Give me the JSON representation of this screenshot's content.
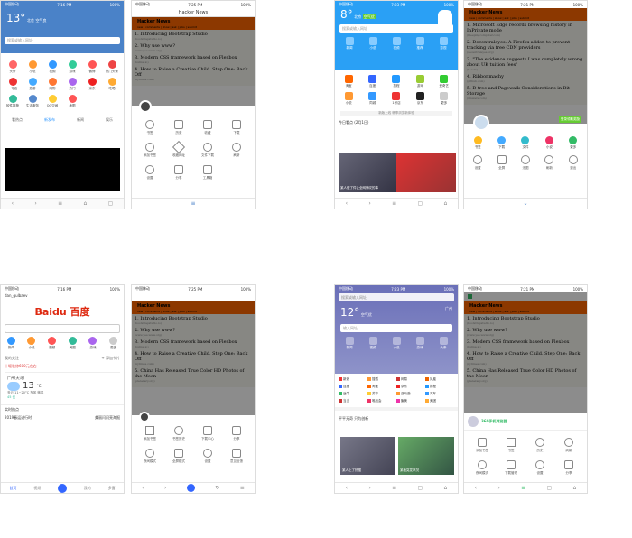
{
  "status": {
    "carrier": "中国移动",
    "time_a": "7:16 PM",
    "time_b": "7:25 PM",
    "time_c": "7:23 PM",
    "time_d": "7:21 PM",
    "battery": "100%"
  },
  "s1": {
    "temp": "13°",
    "city": "北京",
    "sub": "空气良",
    "search_placeholder": "搜索或输入网址",
    "icons_row1": [
      "头条",
      "小说",
      "视频",
      "游戏",
      "微博",
      "热门头条"
    ],
    "icons_row2": [
      "一号店",
      "旅游",
      "网购",
      "热门",
      "京东",
      "吃喝"
    ],
    "icons_row3": [
      "软件推荐",
      "生活服务",
      "QQ空间",
      "地图"
    ],
    "tabs": [
      "看热点",
      "新发布",
      "新闻",
      "娱乐"
    ]
  },
  "hn": {
    "title": "Hacker News",
    "subtitle": "new | comments | show | ask | jobs | submit",
    "login": "login",
    "items": [
      {
        "n": "1.",
        "title": "Introducing Bootstrap Studio",
        "meta": "(bootstrapstudio.io)"
      },
      {
        "n": "2.",
        "title": "Why use www?",
        "meta": "(www.yes-www.org)"
      },
      {
        "n": "3.",
        "title": "Modern CSS framework based on Flexbox",
        "meta": "(bulma.io)"
      },
      {
        "n": "4.",
        "title": "How to Raise a Creative Child. Step One: Back Off",
        "meta": "(nytimes.com)"
      },
      {
        "n": "5.",
        "title": "China Has Released True Color HD Photos of the Moon",
        "meta": "(planetary.org)"
      }
    ],
    "items_alt": [
      {
        "n": "1.",
        "title": "Microsoft Edge records browsing history in InPrivate mode",
        "meta": "(bleepingcomputer.com)"
      },
      {
        "n": "2.",
        "title": "Decentraleyes: A Firefox addon to prevent tracking via free CDN providers",
        "meta": "(decentraleyes.org)"
      },
      {
        "n": "3.",
        "title": "\"The evidence suggests I was completely wrong about UK tuition fees\"",
        "meta": "(ft.com)"
      },
      {
        "n": "4.",
        "title": "Ribbonmachy",
        "meta": "(github.com)"
      },
      {
        "n": "5.",
        "title": "B-tree and Pagewalk Considerations in Bit Storage",
        "meta": "(vmware.com)"
      }
    ]
  },
  "s2_menu": [
    "书签",
    "历史",
    "收藏",
    "下载",
    "添加书签",
    "收藏网址",
    "文件下载",
    "刷新",
    "设置",
    "分享",
    "工具箱"
  ],
  "s3": {
    "temp": "8°",
    "city": "北京",
    "sub": "空气优",
    "search_placeholder": "搜索或输入网址",
    "nav": [
      "新闻",
      "小说",
      "视频",
      "推荐",
      "影视"
    ],
    "icons": [
      "淘宝",
      "百度",
      "携程",
      "游戏",
      "爱奇艺",
      "小说",
      "同城",
      "1号店",
      "京东",
      "更多"
    ],
    "notice": "新版上线 畅享浏览新体验",
    "news_label": "今日看点 (2月1日)",
    "news_caption": "某人做了件让全网惊叹的事"
  },
  "s4_menu": [
    "书签",
    "下载",
    "文件",
    "小说",
    "更多",
    "设置",
    "全屏",
    "无图",
    "刷新",
    "退出"
  ],
  "s4_badge": "登录领取奖励",
  "s5": {
    "user": "dan_gulbaev",
    "logo": "Baidu 百度",
    "search_placeholder": "",
    "icons": [
      "新闻",
      "小说",
      "视频",
      "美图",
      "游戏",
      "更多"
    ],
    "hot_label": "我的关注",
    "add_card": "+ 添加卡片",
    "news_red": "十堰装修600元左右",
    "weather_title": "广州(天河)",
    "weather_temp": "13",
    "weather_unit": "°C",
    "weather_desc": "多云 11~20°C 东风 微风",
    "air": "45 优",
    "live_title": "实时热点",
    "live_item1": "2019春运进行时",
    "live_item2": "美丽闪闪亮海报",
    "tabs": [
      "首页",
      "视频",
      "",
      "我的",
      "多窗"
    ]
  },
  "s6_menu": [
    "添加书签",
    "书签历史",
    "下载中心",
    "分享",
    "夜间模式",
    "全屏模式",
    "设置",
    "意见反馈"
  ],
  "s7": {
    "temp": "12°",
    "city": "广州",
    "sub": "空气优",
    "search_placeholder": "输入网址",
    "nav": [
      "新闻",
      "视频",
      "小说",
      "游戏",
      "头条"
    ],
    "icons": [
      "新浪",
      "搜狐",
      "网易",
      "凤凰",
      "百度",
      "淘宝",
      "京东",
      "携程",
      "途牛",
      "苏宁",
      "亚马逊",
      "汽车",
      "当当",
      "唯品会",
      "聚美",
      "美团"
    ],
    "news_label": "平平无奇 只为创新",
    "caption1": "某人上了热搜",
    "caption2": "某地突发状况"
  },
  "s8": {
    "badge": "360手机浏览器",
    "menu": [
      "添加书签",
      "书签",
      "历史",
      "刷新",
      "夜间模式",
      "下载管理",
      "设置",
      "分享"
    ]
  },
  "colors": {
    "hn_orange": "#ff6600",
    "baidu_red": "#de2910",
    "baidu_blue": "#2932e1",
    "uc_blue": "#2aa0f5",
    "qq_blue": "#1a8cff"
  }
}
